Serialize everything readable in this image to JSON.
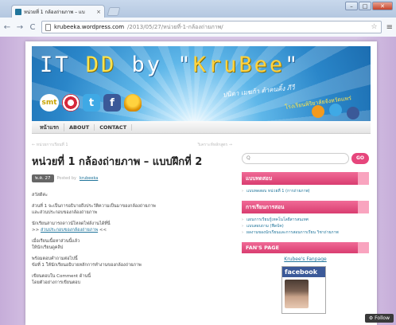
{
  "browser": {
    "tab_title": "หน่วยที่ 1 กล้องถ่ายภาพ – แบ",
    "tab_close": "×",
    "url_host": "krubeeka.wordpress.com",
    "url_path": "/2013/05/27/หน่วยที่-1-กล้องถ่ายภาพ/",
    "back": "←",
    "forward": "→",
    "reload": "C",
    "star": "☆",
    "menu": "≡",
    "minimize": "–",
    "maximize": "□",
    "close": "✕"
  },
  "banner": {
    "title_w1": "IT ",
    "title_d": "DD",
    "title_w2": " by \"",
    "title_s": "KruBee",
    "title_w3": "\"",
    "subtitle": "ปนิดา เมฆก้า ต้าคนคิ้ง ภีวี",
    "subtitle2": "โรงเรียนพิริยาลัยจังหวัดแพร่",
    "smt": "smt",
    "icons": [
      "smt-logo",
      "target",
      "twitter",
      "facebook",
      "monument"
    ]
  },
  "nav": {
    "items": [
      "หน้าแรก",
      "ABOUT",
      "CONTACT"
    ]
  },
  "post": {
    "prev": "← หน่วยการเรียนที่ 1",
    "next": "วิเคราะห์หลักสูตร →",
    "title": "หน่วยที่ 1 กล้องถ่ายภาพ – แบบฝึกที่ 2",
    "date": "พ.ค. 27",
    "posted_by": "Posted by",
    "author": "krubeeka",
    "p1": "สวัสดีค่ะ",
    "p2a": "ส่วนที่ 1 จะเป็นการอธิบายถึงประวัติความเป็นมาของกล้องถ่ายภาพ",
    "p2b": "และส่วนประกอบของกล้องถ่ายภาพ",
    "p3a": "นักเรียนสามารถดาวน์โหลดไฟล์งานได้ที่นี่",
    "p3b_prefix": ">> ",
    "p3b_link": "ส่วนประกอบของกล้องถ่ายภาพ",
    "p3b_suffix": " <<",
    "p4a": "เมื่อเรียนเนื้อหาส่วนนี้แล้ว",
    "p4b": "ให้นักเรียนดูคลิป",
    "p5a": "พร้อมตอบคำถามต่อไปนี้",
    "p5b": "ข้อที่ 1 ให้นักเรียนอธิบายหลักการทำงานของกล้องถ่ายภาพ",
    "p6a": "เขียนตอบใน Comment ด้านนี้",
    "p6b": "โดยตัวอย่างการเขียนตอบ"
  },
  "sidebar": {
    "search_placeholder": "Q",
    "search_button": "GO",
    "w1_title": "แบบทดสอบ",
    "w1_items": [
      "แบบทดสอบ หน่วยที่ 1 (การถ่ายภาพ)"
    ],
    "w2_title": "การเรียนการสอน",
    "w2_items": [
      "แผนการเรียนรู้เทคโนโลยีสารสนเทศ",
      "แบบสอบถาม (ฟีดบ้ค)",
      "ผลงานของนักเรียนและการสอนการเรียน วิชาถ่ายภาพ"
    ],
    "w3_title": "FAN'S PAGE",
    "fan_link": "Krubee's Fanpage",
    "facebook": "facebook"
  },
  "dock": "⚙ Follow",
  "colors": {
    "accent_pink": "#e6467c",
    "link": "#21759b",
    "page_bg": "#c9b6dd"
  }
}
